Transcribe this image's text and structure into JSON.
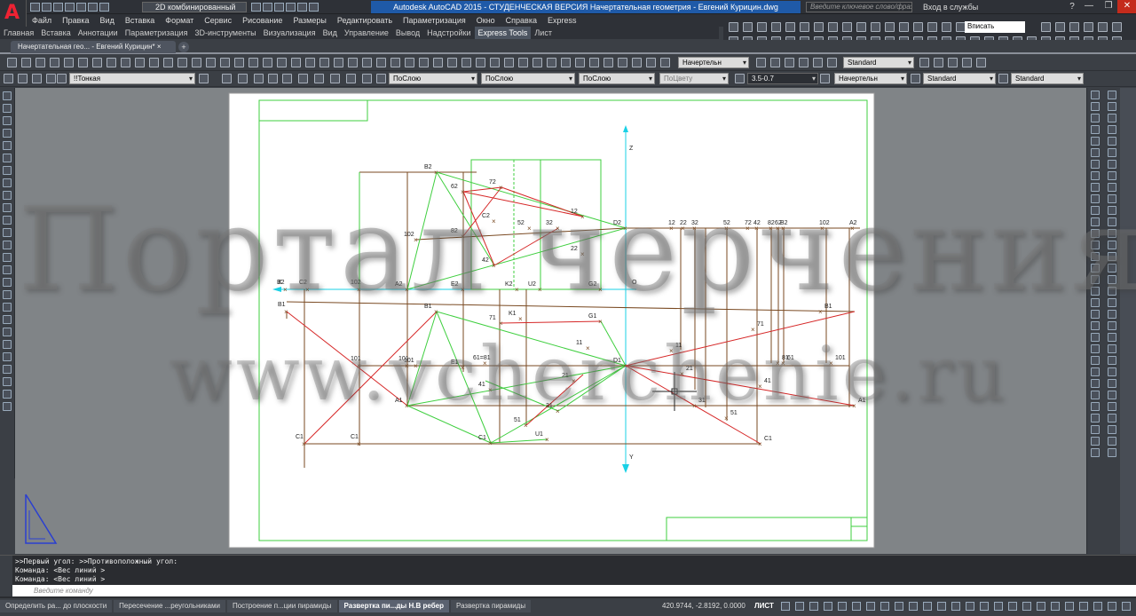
{
  "app": {
    "workspace": "2D комбинированный",
    "window_title": "Autodesk AutoCAD 2015 - СТУДЕНЧЕСКАЯ ВЕРСИЯ   Начертательная геометрия - Евгений Курицин.dwg",
    "search_placeholder": "Введите ключевое слово/фразу",
    "signin": "Вход в службы",
    "help": "?",
    "minimize": "—",
    "restore": "❐",
    "close": "✕"
  },
  "menu": [
    "Файл",
    "Правка",
    "Вид",
    "Вставка",
    "Формат",
    "Сервис",
    "Рисование",
    "Размеры",
    "Редактировать",
    "Параметризация",
    "Окно",
    "Справка",
    "Express"
  ],
  "ribbon_tabs": [
    "Главная",
    "Вставка",
    "Аннотации",
    "Параметризация",
    "3D-инструменты",
    "Визуализация",
    "Вид",
    "Управление",
    "Вывод",
    "Надстройки",
    "Express Tools",
    "Лист"
  ],
  "ribbon_active": "Express Tools",
  "view_fit": "Вписать",
  "doc_tab": "Начертательная гео... - Евгений Курицин*",
  "doc_tab_close": "×",
  "toolbar2": {
    "layer": "!!Тонкая",
    "color": "ПоСлою",
    "linetype": "ПоСлою",
    "lineweight": "ПоСлою",
    "plotstyle": "ПоЦвету",
    "dimscale": "3.5-0.7",
    "textstyle1": "Начертельн",
    "dimstyle": "Standard",
    "tablestyle": "Standard",
    "mleaderstyle": "Standard"
  },
  "toolbar1": {
    "textstyle": "Начертельн",
    "style": "Standard"
  },
  "watermark": {
    "line1": "Портал черчения",
    "line2": "www.vcherchenie.ru"
  },
  "drawing": {
    "axis_labels": {
      "z": "Z",
      "y": "Y",
      "x": "X",
      "o": "O"
    },
    "points_green": [
      {
        "label": "B2"
      },
      {
        "label": "62"
      },
      {
        "label": "72"
      },
      {
        "label": "C2"
      },
      {
        "label": "52"
      },
      {
        "label": "32"
      },
      {
        "label": "12"
      },
      {
        "label": "D2"
      },
      {
        "label": "82"
      },
      {
        "label": "102"
      },
      {
        "label": "42"
      },
      {
        "label": "22"
      },
      {
        "label": "A2"
      },
      {
        "label": "E2"
      },
      {
        "label": "K2"
      },
      {
        "label": "U2"
      },
      {
        "label": "G2"
      },
      {
        "label": "B1"
      },
      {
        "label": "71"
      },
      {
        "label": "K1"
      },
      {
        "label": "G1"
      },
      {
        "label": "11"
      },
      {
        "label": "D1"
      },
      {
        "label": "E1"
      },
      {
        "label": "61=81"
      },
      {
        "label": "101"
      },
      {
        "label": "21"
      },
      {
        "label": "A1"
      },
      {
        "label": "41"
      },
      {
        "label": "31"
      },
      {
        "label": "51"
      },
      {
        "label": "C1"
      },
      {
        "label": "U1"
      }
    ],
    "points_brown_top": [
      "12",
      "22",
      "32",
      "52",
      "72",
      "42",
      "82",
      "62",
      "B2",
      "102",
      "A2"
    ],
    "points_brown_left": [
      "C2",
      "B2",
      "102",
      "C1",
      "C1",
      "B1",
      "101",
      "101"
    ],
    "points_brown_right": [
      "B1",
      "71",
      "11",
      "81",
      "61",
      "101",
      "21",
      "31",
      "41",
      "A1",
      "51",
      "C1"
    ]
  },
  "command": {
    "line1": ">>Первый угол: >>Противоположный угол:",
    "line2": "Команда:  <Вес линий >",
    "line3": "Команда:  <Вес линий >",
    "placeholder": "Введите команду"
  },
  "layout_tabs": [
    "Определить ра... до плоскости",
    "Пересечение ...реугольниками",
    "Построение п...ции пирамиды",
    "Развертка пи...ды Н.В ребер",
    "Развертка пирамиды"
  ],
  "layout_active": "Развертка пи...ды Н.В ребер",
  "status": {
    "coords": "420.9744, -2.8192, 0.0000",
    "space": "ЛИСТ"
  },
  "colors": {
    "green": "#3fcf3f",
    "brown": "#7a4a22",
    "red": "#d62828",
    "cyan": "#19d1e6",
    "accent_title": "#1f5aa8"
  }
}
